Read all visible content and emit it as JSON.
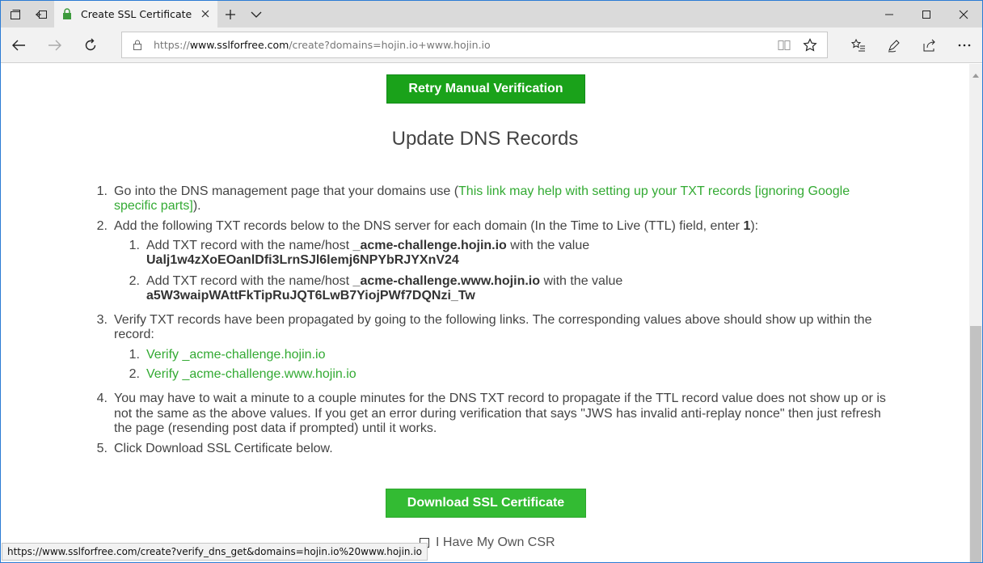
{
  "tab": {
    "title": "Create SSL Certificate"
  },
  "address": {
    "prefix": "https://",
    "domain": "www.sslforfree.com",
    "path": "/create?domains=hojin.io+www.hojin.io"
  },
  "page": {
    "retry_label": "Retry Manual Verification",
    "heading": "Update DNS Records",
    "step1": {
      "num": "1.",
      "text": "Go into the DNS management page that your domains use (",
      "link": "This link may help with setting up your TXT records [ignoring Google",
      "link2": "specific parts]",
      "tail": ")."
    },
    "step2": {
      "num": "2.",
      "text": "Add the following TXT records below to the DNS server for each domain (In the Time to Live (TTL) field, enter ",
      "ttl": "1",
      "tail": "):"
    },
    "step2_sub": [
      {
        "num": "1.",
        "pre": "Add TXT record with the name/host ",
        "host": "_acme-challenge.hojin.io",
        "post": " with the value",
        "value": "Ualj1w4zXoEOanlDfi3LrnSJl6lemj6NPYbRJYXnV24"
      },
      {
        "num": "2.",
        "pre": "Add TXT record with the name/host ",
        "host": "_acme-challenge.www.hojin.io",
        "post": " with the value",
        "value": "a5W3waipWAttFkTipRuJQT6LwB7YiojPWf7DQNzi_Tw"
      }
    ],
    "step3": {
      "num": "3.",
      "line1": "Verify TXT records have been propagated by going to the following links. The corresponding values above should show up within the",
      "line2": "record:"
    },
    "step3_sub": [
      {
        "num": "1.",
        "text": "Verify _acme-challenge.hojin.io"
      },
      {
        "num": "2.",
        "text": "Verify _acme-challenge.www.hojin.io"
      }
    ],
    "step4": {
      "num": "4.",
      "line1": "You may have to wait a minute to a couple minutes for the DNS TXT record to propagate if the TTL record value does not show up or is",
      "line2": "not the same as the above values. If you get an error during verification that says \"JWS has invalid anti-replay nonce\" then just refresh",
      "line3": "the page (resending post data if prompted) until it works."
    },
    "step5": {
      "num": "5.",
      "text": "Click Download SSL Certificate below."
    },
    "download_label": "Download SSL Certificate",
    "csr_label": "I Have My Own CSR"
  },
  "status_url": "https://www.sslforfree.com/create?verify_dns_get&domains=hojin.io%20www.hojin.io",
  "colors": {
    "accent_green": "#1aa21a",
    "link_green": "#33aa33",
    "window_border": "#2b7bd4"
  }
}
